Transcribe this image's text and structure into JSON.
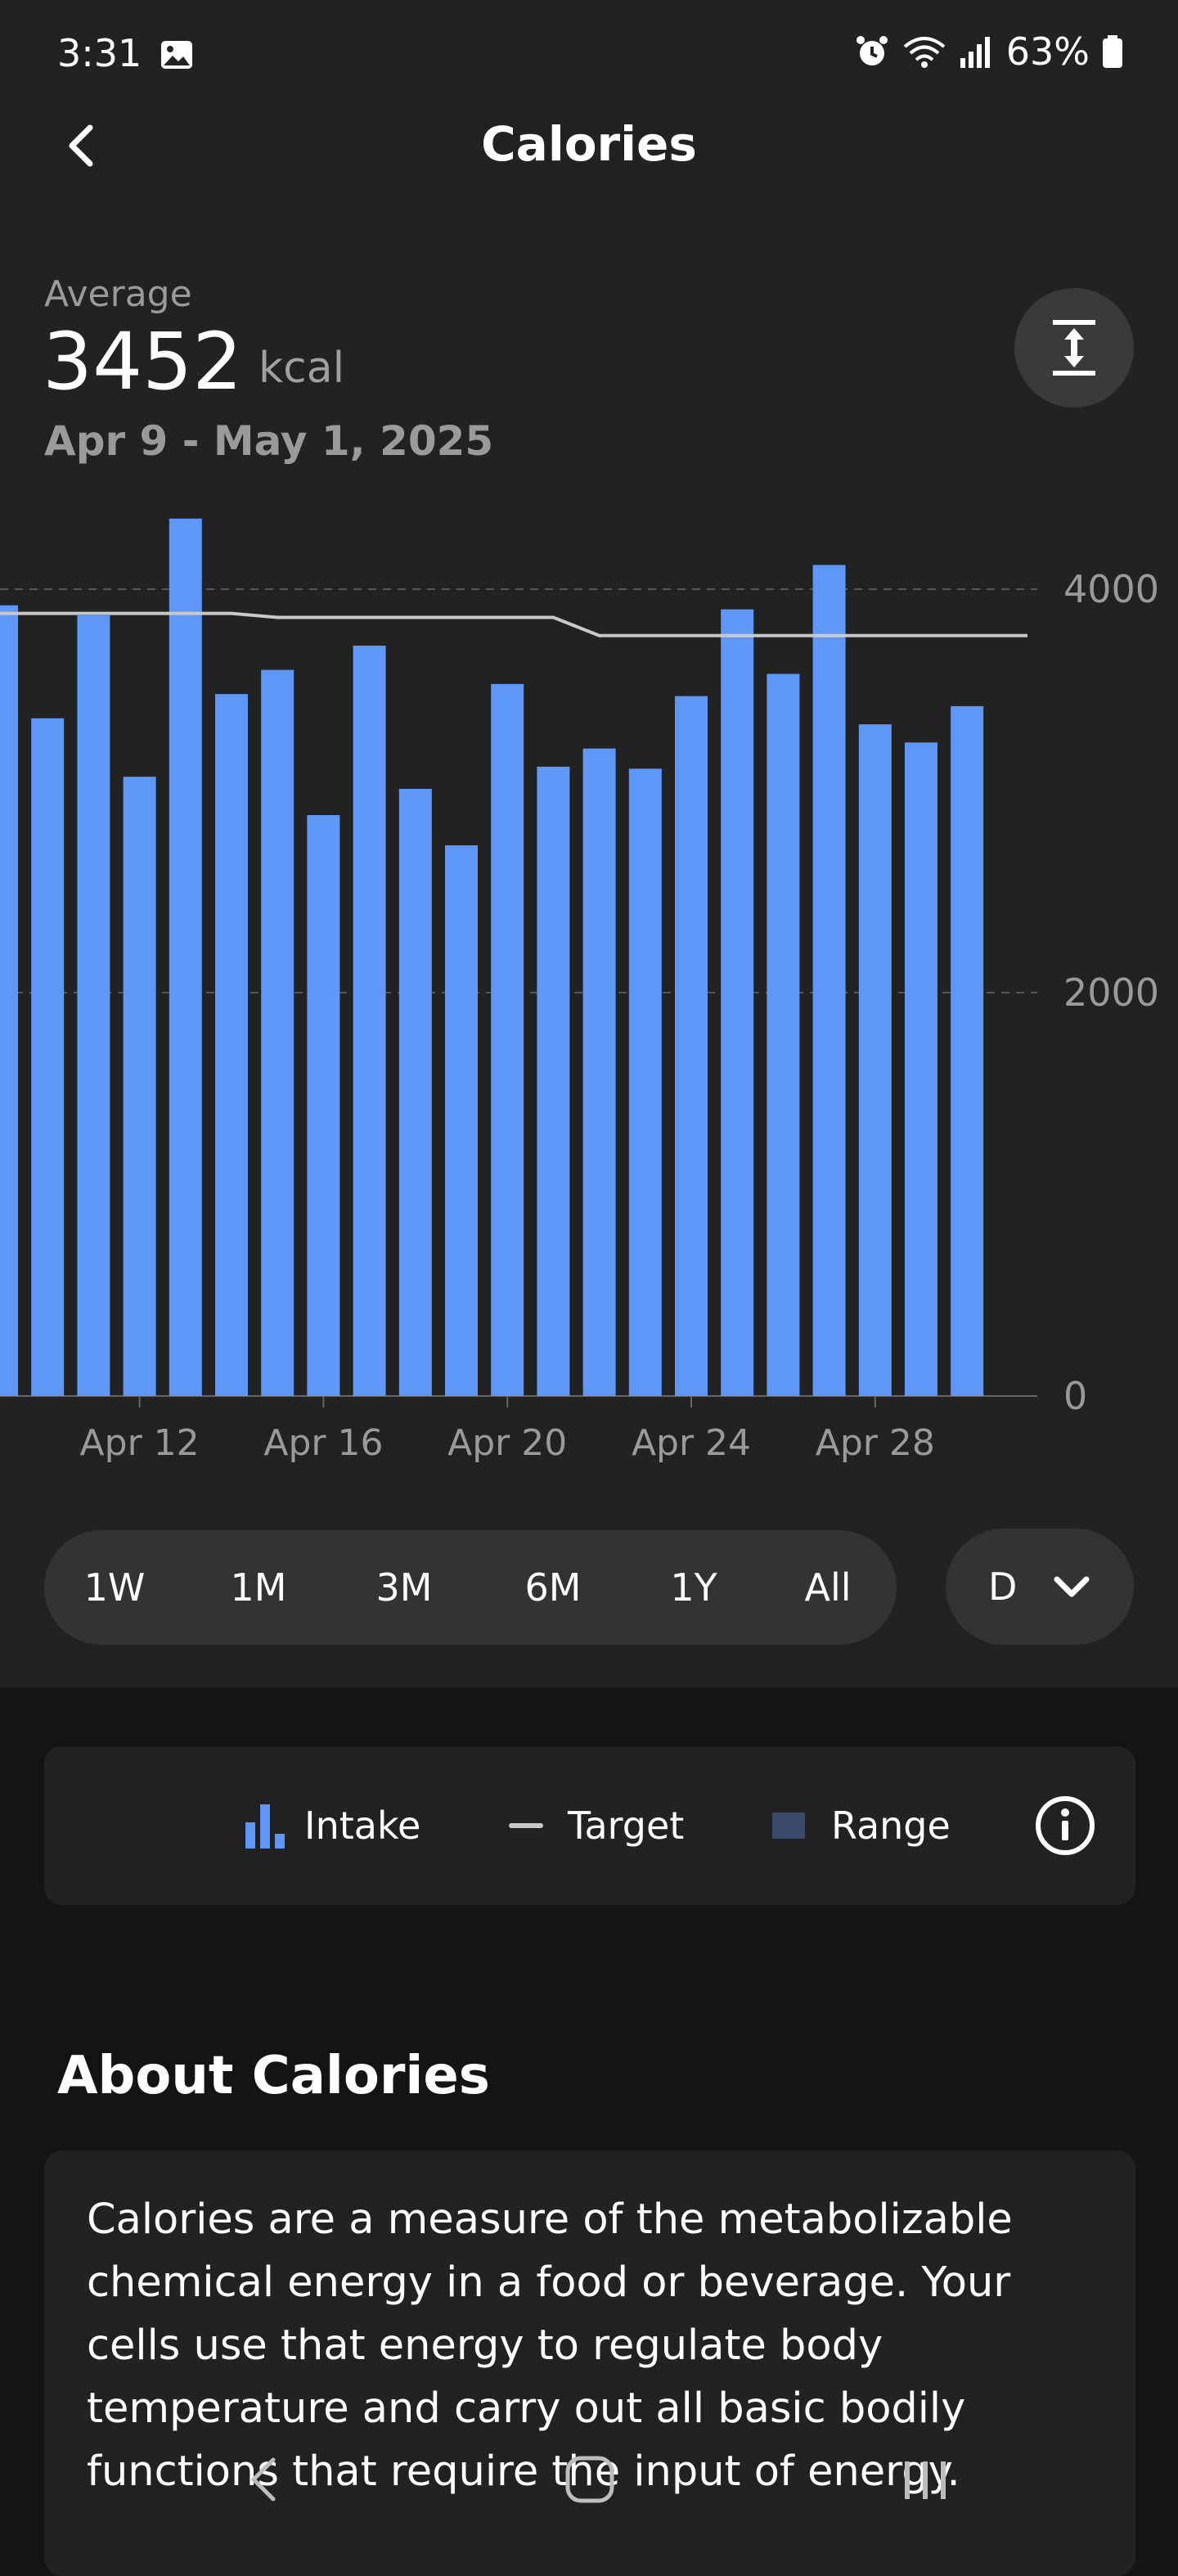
{
  "status_bar": {
    "time": "3:31",
    "battery": "63%",
    "icons": [
      "gallery-icon",
      "alarm-icon",
      "wifi-6e-icon",
      "signal-icon",
      "battery-icon"
    ]
  },
  "header": {
    "title": "Calories"
  },
  "summary": {
    "label": "Average",
    "value": "3452",
    "unit": "kcal",
    "date_range": "Apr 9 - May 1, 2025"
  },
  "chart_data": {
    "type": "bar",
    "categories": [
      "Apr 9",
      "Apr 10",
      "Apr 11",
      "Apr 12",
      "Apr 13",
      "Apr 14",
      "Apr 15",
      "Apr 16",
      "Apr 17",
      "Apr 18",
      "Apr 19",
      "Apr 20",
      "Apr 21",
      "Apr 22",
      "Apr 23",
      "Apr 24",
      "Apr 25",
      "Apr 26",
      "Apr 27",
      "Apr 28",
      "Apr 29",
      "Apr 30"
    ],
    "series": [
      {
        "name": "Intake",
        "values": [
          3920,
          3360,
          3870,
          3070,
          4350,
          3480,
          3600,
          2880,
          3720,
          3010,
          2730,
          3530,
          3120,
          3210,
          3110,
          3470,
          3900,
          3580,
          4120,
          3330,
          3240,
          3420
        ]
      },
      {
        "name": "Target",
        "values": [
          3880,
          3880,
          3880,
          3880,
          3880,
          3880,
          3860,
          3860,
          3860,
          3860,
          3860,
          3860,
          3860,
          3770,
          3770,
          3770,
          3770,
          3770,
          3770,
          3770,
          3770,
          3770
        ]
      }
    ],
    "y_ticks": [
      "4000",
      "2000",
      "0"
    ],
    "x_tick_labels": [
      "Apr 12",
      "Apr 16",
      "Apr 20",
      "Apr 24",
      "Apr 28"
    ],
    "ylim": [
      0,
      4000
    ],
    "grid": "dashed horizontal",
    "colors": {
      "intake": "#5f97f7",
      "target": "#c9c9c9",
      "range": "#3a4a6b"
    }
  },
  "time_ranges": {
    "options": [
      "1W",
      "1M",
      "3M",
      "6M",
      "1Y",
      "All"
    ],
    "granularity": "D"
  },
  "legend": {
    "intake": "Intake",
    "target": "Target",
    "range": "Range"
  },
  "about": {
    "title": "About Calories",
    "text": "Calories are a measure of the metabolizable chemical energy in a food or beverage. Your cells use that energy to regulate body temperature and carry out all basic bodily functions that require the input of energy."
  },
  "nav_bar": {
    "icons": [
      "back-nav-icon",
      "home-nav-icon",
      "recents-nav-icon"
    ]
  }
}
